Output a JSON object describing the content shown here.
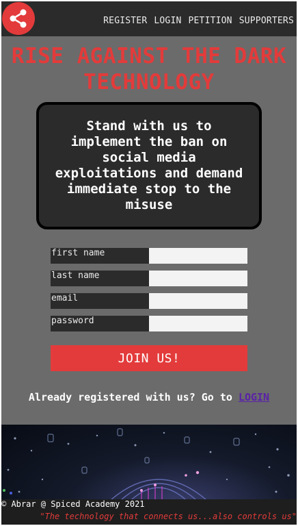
{
  "header": {
    "logo_icon": "share-icon",
    "nav": [
      "REGISTER",
      "LOGIN",
      "PETITION",
      "SUPPORTERS"
    ]
  },
  "title": "RISE AGAINST THE DARK TECHNOLOGY",
  "card": {
    "text": "Stand with us to implement the ban on social media exploitations and demand immediate stop to the misuse"
  },
  "form": {
    "fields": [
      {
        "label": "first name",
        "value": ""
      },
      {
        "label": "last name",
        "value": ""
      },
      {
        "label": "email",
        "value": ""
      },
      {
        "label": "password",
        "value": ""
      }
    ],
    "submit_label": "JOIN US!"
  },
  "login_prompt": {
    "text": "Already registered with us? Go to",
    "link": "LOGIN"
  },
  "footer": {
    "copyright": "© Abrar @ Spiced Academy 2021",
    "quote": "\"The technology that connects us...also controls us\""
  },
  "colors": {
    "accent": "#e33b3b",
    "page_bg": "#6b6b6b",
    "dark": "#2b2b2b",
    "link": "#5a22a8"
  }
}
